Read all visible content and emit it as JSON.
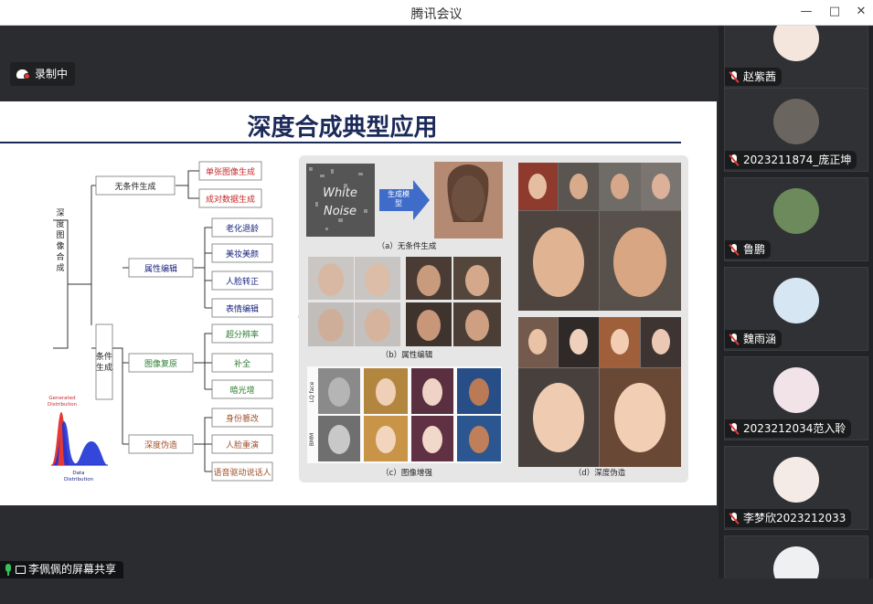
{
  "window": {
    "title": "腾讯会议"
  },
  "recording": {
    "label": "录制中"
  },
  "slide": {
    "title": "深度合成典型应用",
    "tree": {
      "root": "深度图像合成",
      "unconditional": {
        "label": "无条件生成",
        "children": [
          "单张图像生成",
          "成对数据生成"
        ]
      },
      "conditional": "条件生成",
      "groups": [
        {
          "label": "属性编辑",
          "children": [
            "老化退龄",
            "美妆美颜",
            "人脸转正",
            "表情编辑"
          ]
        },
        {
          "label": "图像复原",
          "children": [
            "超分辨率",
            "补全",
            "暗光增"
          ]
        },
        {
          "label": "深度伪造",
          "children": [
            "身份篡改",
            "人脸重演",
            "语音驱动说话人"
          ]
        }
      ],
      "dist_generated": "Generated Distribution",
      "dist_data": "Data Distribution"
    },
    "panels": {
      "white_noise": "White Noise",
      "arrow": "生成模型",
      "a": "（a）无条件生成",
      "b": "（b）属性编辑",
      "c": "（c）图像增强",
      "c_row1": "LQ face",
      "c_row2": "BMM",
      "d": "（d）深度伪造"
    }
  },
  "screen_share": {
    "label": "李佩佩的屏幕共享"
  },
  "participants": [
    {
      "name": "赵紫茜",
      "muted": true
    },
    {
      "name": "2023211874_庞正坤",
      "muted": true
    },
    {
      "name": "鲁鹏",
      "muted": true
    },
    {
      "name": "魏雨涵",
      "muted": true
    },
    {
      "name": "2023212034范入聆",
      "muted": true
    },
    {
      "name": "李梦欣2023212033",
      "muted": true
    },
    {
      "name": "",
      "muted": true
    }
  ],
  "colors": {
    "accent_red": "#e53935",
    "title_navy": "#1c2a5a",
    "green": "#37c35b"
  }
}
